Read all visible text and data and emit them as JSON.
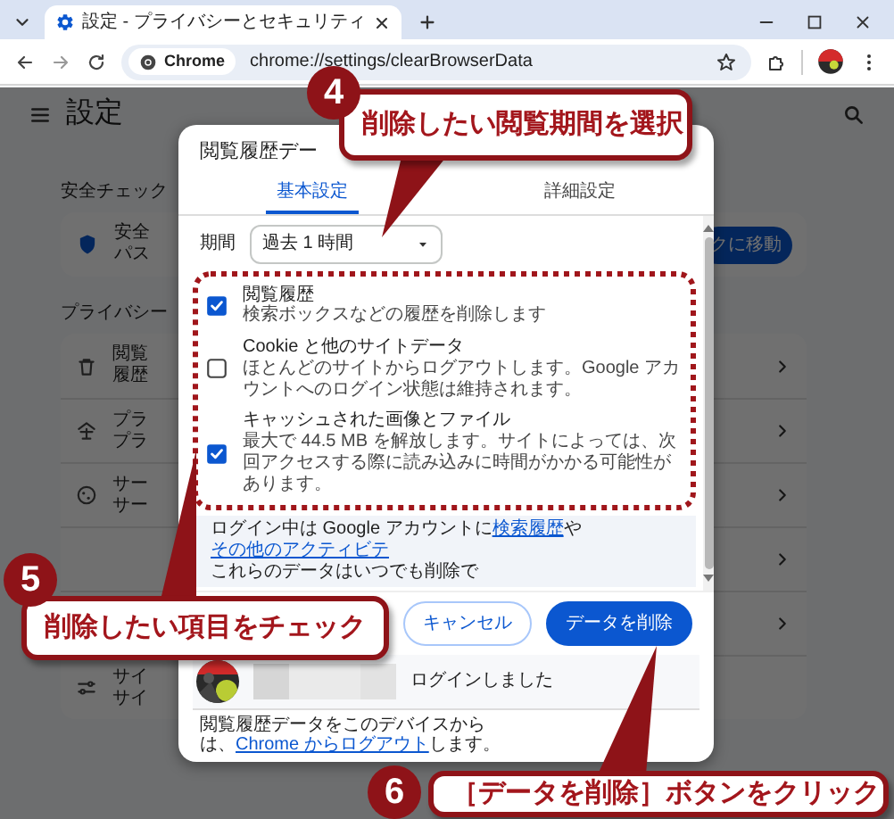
{
  "browser": {
    "tab_title": "設定 - プライバシーとセキュリティ",
    "chip_label": "Chrome",
    "url": "chrome://settings/clearBrowserData"
  },
  "page": {
    "title": "設定",
    "safety": {
      "heading": "安全チェック",
      "line_1": "安全",
      "line_2": "パス",
      "action": "クに移動"
    },
    "privacy": {
      "heading": "プライバシー",
      "rows": [
        {
          "kind": "trash",
          "line_1": "閲覧",
          "line_2": "履歴",
          "chevron": true
        },
        {
          "kind": "roof",
          "line_1": "プラ",
          "line_2": "プラ",
          "chevron": true
        },
        {
          "kind": "cookie",
          "line_1": "サー",
          "line_2": "サー",
          "chevron": true
        },
        {
          "kind": "hidden",
          "chevron": true
        },
        {
          "kind": "hidden",
          "chevron": true
        },
        {
          "kind": "sliders",
          "line_1": "サイ",
          "line_2": "サイ",
          "chevron": false
        }
      ]
    }
  },
  "dialog": {
    "title": "閲覧履歴デー",
    "tabs": [
      {
        "label": "基本設定",
        "selected": true
      },
      {
        "label": "詳細設定",
        "selected": false
      }
    ],
    "period": {
      "label": "期間",
      "value": "過去 1 時間"
    },
    "items": [
      {
        "title": "閲覧履歴",
        "description": "検索ボックスなどの履歴を削除します",
        "checked": true
      },
      {
        "title": "Cookie と他のサイトデータ",
        "description": "ほとんどのサイトからログアウトします。Google アカウントへのログイン状態は維持されます。",
        "checked": false
      },
      {
        "title": "キャッシュされた画像とファイル",
        "description": "最大で 44.5 MB を解放します。サイトによっては、次回アクセスする際に読み込みに時間がかかる可能性があります。",
        "checked": true
      }
    ],
    "notice": {
      "line_1": [
        {
          "text": "ログイン中は Google アカウントに",
          "link": false
        },
        {
          "text": "検索履歴",
          "link": true
        },
        {
          "text": "や",
          "link": false
        },
        {
          "text": "その他のアクティビテ",
          "link": true
        }
      ],
      "line_2": "これらのデータはいつでも削除で"
    },
    "buttons": [
      {
        "label": "キャンセル",
        "kind": "secondary"
      },
      {
        "label": "データを削除",
        "kind": "primary"
      }
    ],
    "account_text": "ログインしました",
    "footer": {
      "line_1": "閲覧履歴データをこのデバイスから",
      "line_2": [
        {
          "text": "は、",
          "link": false
        },
        {
          "text": "Chrome からログアウト",
          "link": true
        },
        {
          "text": "します。",
          "link": false
        }
      ]
    }
  },
  "callouts": [
    {
      "number": "4",
      "text": "削除したい閲覧期間を選択"
    },
    {
      "number": "5",
      "text": "削除したい項目をチェック"
    },
    {
      "number": "6",
      "text": "［データを削除］ボタンをクリック"
    }
  ]
}
